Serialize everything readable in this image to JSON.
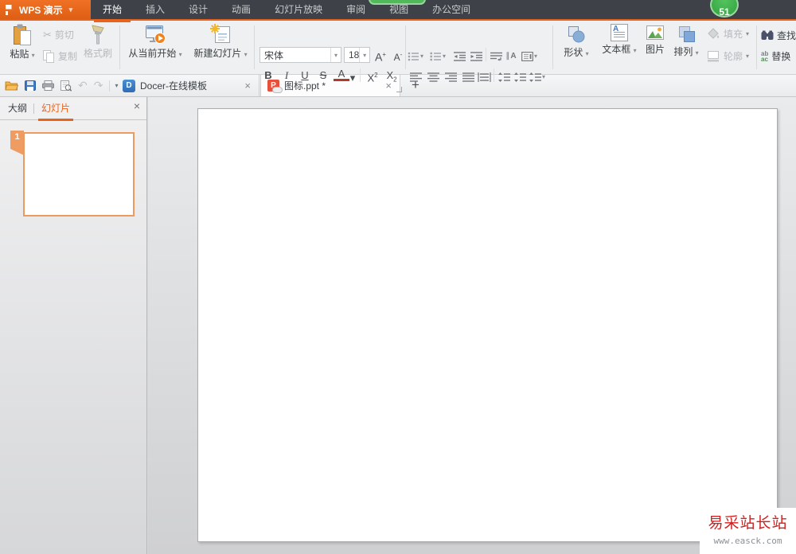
{
  "titlebar": {
    "app": "WPS 演示",
    "tabs": [
      {
        "label": "开始"
      },
      {
        "label": "插入"
      },
      {
        "label": "设计"
      },
      {
        "label": "动画"
      },
      {
        "label": "幻灯片放映"
      },
      {
        "label": "审阅"
      },
      {
        "label": "视图"
      },
      {
        "label": "办公空间"
      }
    ],
    "update_badge": "51"
  },
  "ribbon": {
    "paste": "粘贴",
    "cut": "剪切",
    "copy": "复制",
    "format_painter": "格式刷",
    "start_from_current": "从当前开始",
    "new_slide": "新建幻灯片",
    "font_name": "宋体",
    "font_size": "18",
    "grow_base": "A",
    "grow_mark": "+",
    "shrink_base": "A",
    "shrink_mark": "-",
    "bold": "B",
    "italic": "I",
    "underline": "U",
    "strikethrough": "S",
    "font_color": "A",
    "sup_base": "X",
    "sup_mark": "2",
    "sub_base": "X",
    "sub_mark": "2",
    "vertical_bars": "∥",
    "vertical_letter": "A",
    "shapes": "形状",
    "textbox": "文本框",
    "picture": "图片",
    "arrange": "排列",
    "fill": "填充",
    "outline": "轮廓",
    "find": "查找",
    "replace": "替换",
    "replace_icon_top": "ab",
    "replace_icon_bottom": "ac"
  },
  "docbar": {
    "tabs": [
      {
        "title": "Docer-在线模板"
      },
      {
        "title": "图标.ppt *"
      }
    ]
  },
  "sidebar": {
    "outline_tab": "大纲",
    "slides_tab": "幻灯片",
    "slide_number": "1"
  },
  "watermark": {
    "site": "易采站长站",
    "url": "www.easck.com"
  },
  "icons": {
    "caret": "▾",
    "close": "×",
    "plus": "+",
    "undo": "↶",
    "redo": "↷",
    "scissors": "✂"
  },
  "colors": {
    "accent": "#e8641c",
    "badge_green": "#3db44c"
  }
}
